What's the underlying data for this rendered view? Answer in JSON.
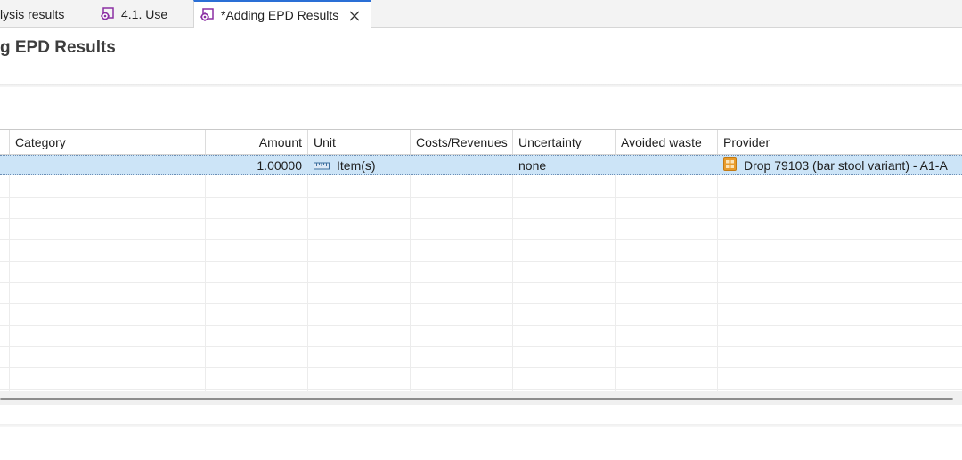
{
  "tabs": [
    {
      "label": "lysis results",
      "icon": "none",
      "active": false
    },
    {
      "label": "4.1. Use",
      "icon": "process-gear-icon",
      "active": false
    },
    {
      "label": "*Adding EPD Results",
      "icon": "process-gear-icon",
      "active": true
    }
  ],
  "page": {
    "title": "g EPD Results"
  },
  "table": {
    "columns": [
      "Category",
      "Amount",
      "Unit",
      "Costs/Revenues",
      "Uncertainty",
      "Avoided waste",
      "Provider"
    ],
    "rows": [
      {
        "category": "",
        "amount": "1.00000",
        "unit": "Item(s)",
        "unit_icon": "unit-ruler-icon",
        "costs_revenues": "",
        "uncertainty": "none",
        "avoided_waste": "",
        "provider": "Drop 79103 (bar stool variant) - A1-A",
        "provider_icon": "product-system-icon"
      }
    ]
  },
  "colors": {
    "accent": "#2a6fd6",
    "selection": "#cce4f7",
    "icon_purple": "#8b2fa3",
    "icon_orange": "#e89b2c"
  }
}
